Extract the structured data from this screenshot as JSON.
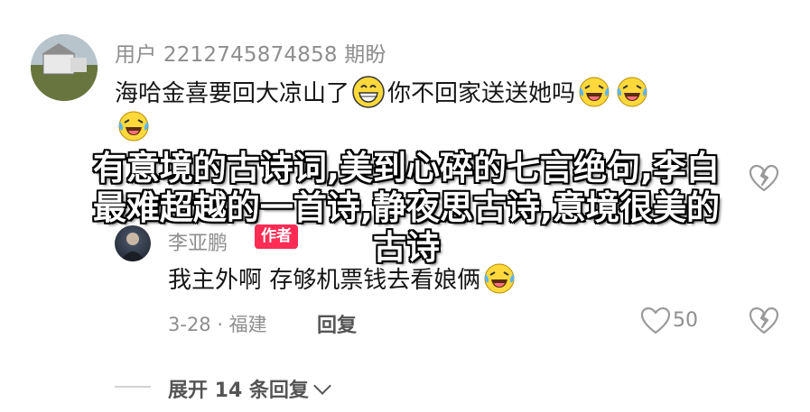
{
  "comment": {
    "username": "用户 2212745874858 期盼",
    "text_part1": "海哈金喜要回大凉山了",
    "text_part2": "你不回家送送她吗"
  },
  "banner": {
    "line1": "有意境的古诗词,美到心碎的七言绝句,李白",
    "line2": "最难超越的一首诗,静夜思古诗,意境很美的",
    "line3": "古诗"
  },
  "reply": {
    "username": "李亚鹏",
    "badge": "作者",
    "text": "我主外啊 存够机票钱去看娘俩",
    "date_location": "3-28 · 福建",
    "reply_label": "回复",
    "like_count": "50"
  },
  "expand": {
    "label": "展开 14 条回复"
  },
  "colors": {
    "badge": "#fe2c55",
    "meta_gray": "#8e8e8e"
  },
  "icons": [
    "grinning-emoji-icon",
    "laughing-tears-emoji-icon",
    "heart-outline-icon",
    "broken-heart-icon",
    "chevron-down-icon"
  ]
}
